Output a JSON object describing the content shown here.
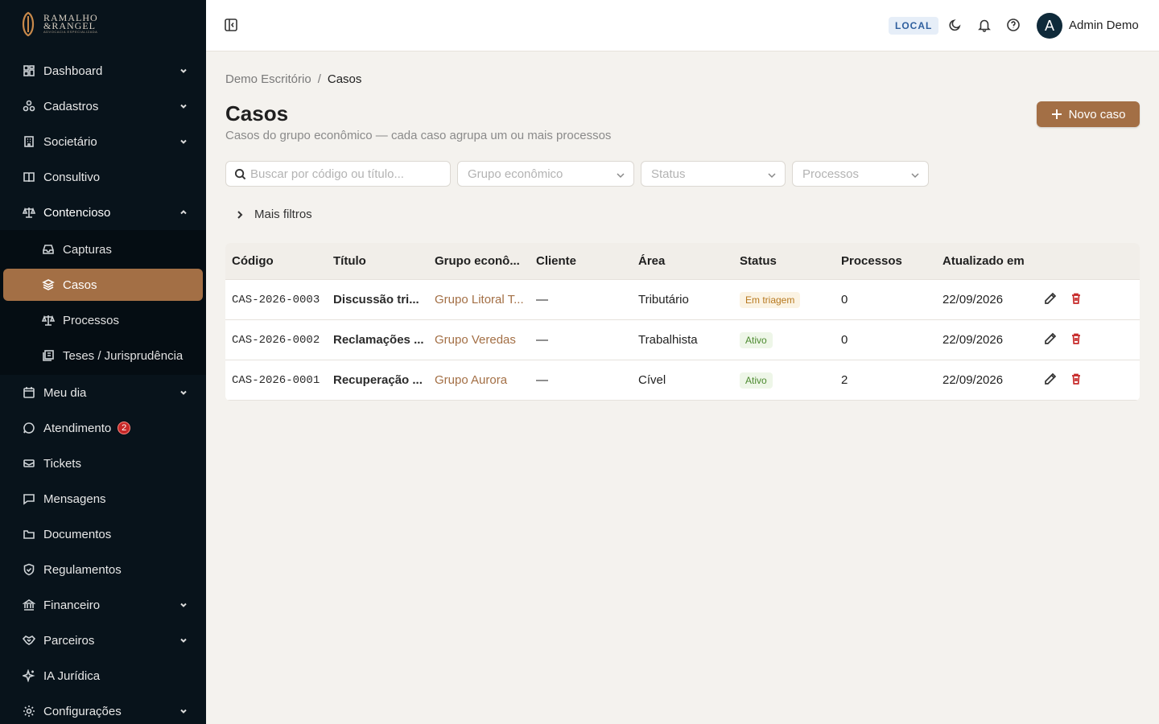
{
  "brand": {
    "name_line1": "RAMALHO",
    "name_line2": "&RANGEL",
    "tagline": "ADVOCACIA ESPECIALIZADA"
  },
  "sidebar": {
    "items": [
      {
        "label": "Dashboard",
        "icon": "dashboard-icon",
        "expandable": true
      },
      {
        "label": "Cadastros",
        "icon": "cadastros-icon",
        "expandable": true
      },
      {
        "label": "Societário",
        "icon": "building-icon",
        "expandable": true
      },
      {
        "label": "Consultivo",
        "icon": "book-icon",
        "expandable": false
      },
      {
        "label": "Contencioso",
        "icon": "scale-icon",
        "expandable": true,
        "expanded": true
      }
    ],
    "sub_items": [
      {
        "label": "Capturas",
        "icon": "inbox-icon"
      },
      {
        "label": "Casos",
        "icon": "layers-icon",
        "active": true
      },
      {
        "label": "Processos",
        "icon": "scale-icon"
      },
      {
        "label": "Teses / Jurisprudência",
        "icon": "library-icon"
      }
    ],
    "items_after": [
      {
        "label": "Meu dia",
        "icon": "calendar-icon",
        "expandable": true
      },
      {
        "label": "Atendimento",
        "icon": "chat-icon",
        "badge": "2"
      },
      {
        "label": "Tickets",
        "icon": "ticket-icon"
      },
      {
        "label": "Mensagens",
        "icon": "message-icon"
      },
      {
        "label": "Documentos",
        "icon": "folder-icon"
      },
      {
        "label": "Regulamentos",
        "icon": "shield-icon"
      },
      {
        "label": "Financeiro",
        "icon": "bank-icon",
        "expandable": true
      },
      {
        "label": "Parceiros",
        "icon": "handshake-icon",
        "expandable": true
      },
      {
        "label": "IA Jurídica",
        "icon": "sparkles-icon"
      },
      {
        "label": "Configurações",
        "icon": "gear-icon",
        "expandable": true
      }
    ]
  },
  "header": {
    "env": "LOCAL",
    "user_initial": "A",
    "user_name": "Admin Demo"
  },
  "breadcrumb": {
    "parent": "Demo Escritório",
    "separator": "/",
    "current": "Casos"
  },
  "page": {
    "title": "Casos",
    "subtitle": "Casos do grupo econômico — cada caso agrupa um ou mais processos",
    "new_button": "Novo caso"
  },
  "filters": {
    "search_placeholder": "Buscar por código ou título...",
    "group_placeholder": "Grupo econômico",
    "status_placeholder": "Status",
    "processes_placeholder": "Processos",
    "more": "Mais filtros"
  },
  "table": {
    "headers": [
      "Código",
      "Título",
      "Grupo econô...",
      "Cliente",
      "Área",
      "Status",
      "Processos",
      "Atualizado em"
    ],
    "rows": [
      {
        "code": "CAS-2026-0003",
        "title": "Discussão tri...",
        "group": "Grupo Litoral T...",
        "client": "—",
        "area": "Tributário",
        "status": "Em triagem",
        "status_kind": "triage",
        "processes": "0",
        "updated": "22/09/2026"
      },
      {
        "code": "CAS-2026-0002",
        "title": "Reclamações ...",
        "group": "Grupo Veredas",
        "client": "—",
        "area": "Trabalhista",
        "status": "Ativo",
        "status_kind": "active",
        "processes": "0",
        "updated": "22/09/2026"
      },
      {
        "code": "CAS-2026-0001",
        "title": "Recuperação ...",
        "group": "Grupo Aurora",
        "client": "—",
        "area": "Cível",
        "status": "Ativo",
        "status_kind": "active",
        "processes": "2",
        "updated": "22/09/2026"
      }
    ]
  },
  "colors": {
    "sidebar_bg": "#08131b",
    "accent": "#a36f45",
    "danger": "#c62828",
    "page_bg": "#f4f2ee"
  }
}
